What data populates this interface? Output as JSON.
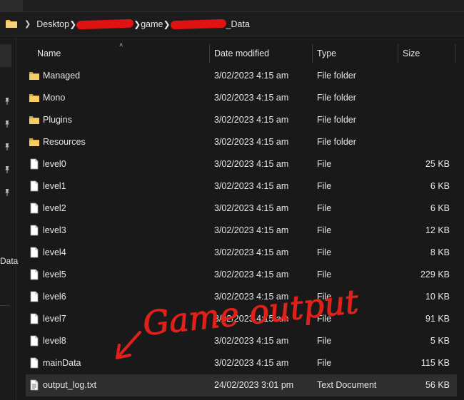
{
  "breadcrumb": {
    "items": [
      {
        "label": "Desktop",
        "redacted": false
      },
      {
        "label": "",
        "redacted": true
      },
      {
        "label": "game",
        "redacted": false
      },
      {
        "label": "_Data",
        "redacted": true
      }
    ]
  },
  "nav_pane": {
    "partial_label": "Data"
  },
  "columns": {
    "name": "Name",
    "date": "Date modified",
    "type": "Type",
    "size": "Size"
  },
  "files": [
    {
      "name": "Managed",
      "date": "3/02/2023 4:15 am",
      "type": "File folder",
      "size": "",
      "icon": "folder-icon"
    },
    {
      "name": "Mono",
      "date": "3/02/2023 4:15 am",
      "type": "File folder",
      "size": "",
      "icon": "folder-icon"
    },
    {
      "name": "Plugins",
      "date": "3/02/2023 4:15 am",
      "type": "File folder",
      "size": "",
      "icon": "folder-icon"
    },
    {
      "name": "Resources",
      "date": "3/02/2023 4:15 am",
      "type": "File folder",
      "size": "",
      "icon": "folder-icon"
    },
    {
      "name": "level0",
      "date": "3/02/2023 4:15 am",
      "type": "File",
      "size": "25 KB",
      "icon": "file-icon"
    },
    {
      "name": "level1",
      "date": "3/02/2023 4:15 am",
      "type": "File",
      "size": "6 KB",
      "icon": "file-icon"
    },
    {
      "name": "level2",
      "date": "3/02/2023 4:15 am",
      "type": "File",
      "size": "6 KB",
      "icon": "file-icon"
    },
    {
      "name": "level3",
      "date": "3/02/2023 4:15 am",
      "type": "File",
      "size": "12 KB",
      "icon": "file-icon"
    },
    {
      "name": "level4",
      "date": "3/02/2023 4:15 am",
      "type": "File",
      "size": "8 KB",
      "icon": "file-icon"
    },
    {
      "name": "level5",
      "date": "3/02/2023 4:15 am",
      "type": "File",
      "size": "229 KB",
      "icon": "file-icon"
    },
    {
      "name": "level6",
      "date": "3/02/2023 4:15 am",
      "type": "File",
      "size": "10 KB",
      "icon": "file-icon"
    },
    {
      "name": "level7",
      "date": "3/02/2023 4:15 am",
      "type": "File",
      "size": "91 KB",
      "icon": "file-icon"
    },
    {
      "name": "level8",
      "date": "3/02/2023 4:15 am",
      "type": "File",
      "size": "5 KB",
      "icon": "file-icon"
    },
    {
      "name": "mainData",
      "date": "3/02/2023 4:15 am",
      "type": "File",
      "size": "115 KB",
      "icon": "file-icon"
    },
    {
      "name": "output_log.txt",
      "date": "24/02/2023 3:01 pm",
      "type": "Text Document",
      "size": "56 KB",
      "icon": "text-document-icon",
      "selected": true
    }
  ],
  "annotation": {
    "text": "Game output",
    "color": "#e0201a"
  },
  "colors": {
    "background": "#191919",
    "selected_row": "#2e2e2e",
    "folder": "#f2c65a",
    "redaction": "#e01313"
  }
}
